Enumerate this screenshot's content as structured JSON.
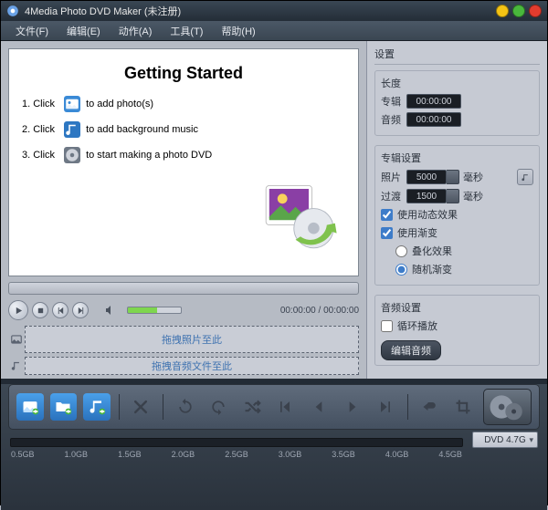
{
  "titlebar": {
    "title": "4Media Photo DVD Maker (未注册)"
  },
  "menu": {
    "file": "文件(F)",
    "edit": "编辑(E)",
    "action": "动作(A)",
    "tools": "工具(T)",
    "help": "帮助(H)"
  },
  "preview": {
    "heading": "Getting Started",
    "step1_num": "1. Click",
    "step1_text": "to add photo(s)",
    "step2_num": "2. Click",
    "step2_text": "to add background music",
    "step3_num": "3. Click",
    "step3_text": "to start making a photo DVD"
  },
  "playback": {
    "time": "00:00:00 / 00:00:00"
  },
  "drop": {
    "photos": "拖拽照片至此",
    "audio": "拖拽音频文件至此"
  },
  "settings": {
    "title": "设置",
    "duration": {
      "header": "长度",
      "album_label": "专辑",
      "album_value": "00:00:00",
      "audio_label": "音频",
      "audio_value": "00:00:00"
    },
    "album": {
      "header": "专辑设置",
      "photo_label": "照片",
      "photo_value": "5000",
      "photo_unit": "毫秒",
      "trans_label": "过渡",
      "trans_value": "1500",
      "trans_unit": "毫秒",
      "use_motion": "使用动态效果",
      "use_transition": "使用渐变",
      "overlap": "叠化效果",
      "random": "随机渐变"
    },
    "audio": {
      "header": "音频设置",
      "loop": "循环播放",
      "edit_btn": "编辑音频"
    }
  },
  "capacity": {
    "ticks": [
      "0.5GB",
      "1.0GB",
      "1.5GB",
      "2.0GB",
      "2.5GB",
      "3.0GB",
      "3.5GB",
      "4.0GB",
      "4.5GB"
    ],
    "selector": "DVD 4.7G"
  }
}
